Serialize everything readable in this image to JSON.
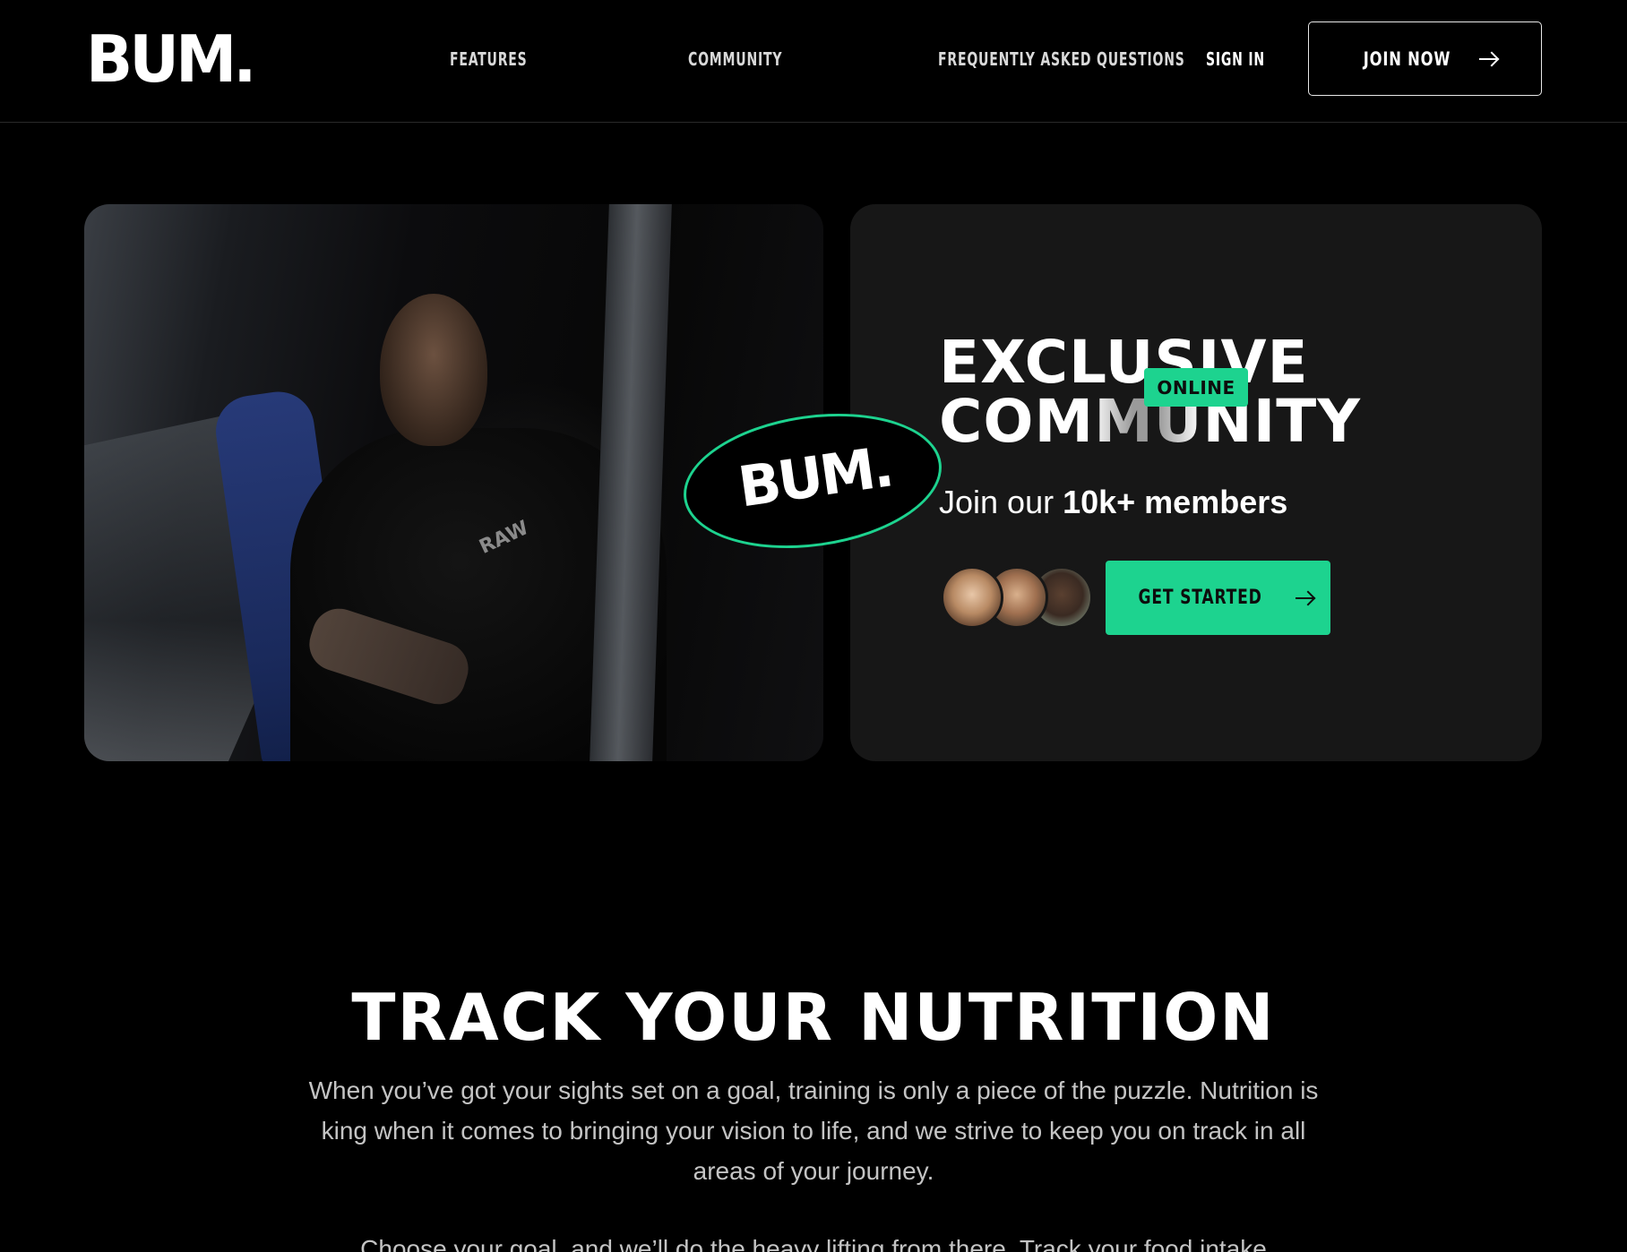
{
  "brand": {
    "logo": "BUM."
  },
  "nav": {
    "links": [
      "FEATURES",
      "COMMUNITY",
      "FREQUENTLY ASKED QUESTIONS"
    ],
    "signin": "SIGN IN",
    "join": "JOIN NOW"
  },
  "hero": {
    "photo_print": "RAW",
    "badge_logo": "BUM.",
    "headline_1": "EXCLUSIVE",
    "headline_2": "COMMUNITY",
    "online_badge": "ONLINE",
    "sub_prefix": "Join our ",
    "sub_bold": "10k+ members",
    "cta": "GET STARTED",
    "accent_color": "#1dd38f",
    "avatars": [
      "member-avatar",
      "member-avatar",
      "member-avatar"
    ]
  },
  "nutrition": {
    "title": "TRACK YOUR NUTRITION",
    "paragraph_1": "When you’ve got your sights set on a goal, training is only a piece of the puzzle. Nutrition is king when it comes to bringing your vision to life, and we strive to keep you on track in all areas of your journey.",
    "paragraph_2": "Choose your goal, and we’ll do the heavy lifting from there. Track your food intake"
  }
}
